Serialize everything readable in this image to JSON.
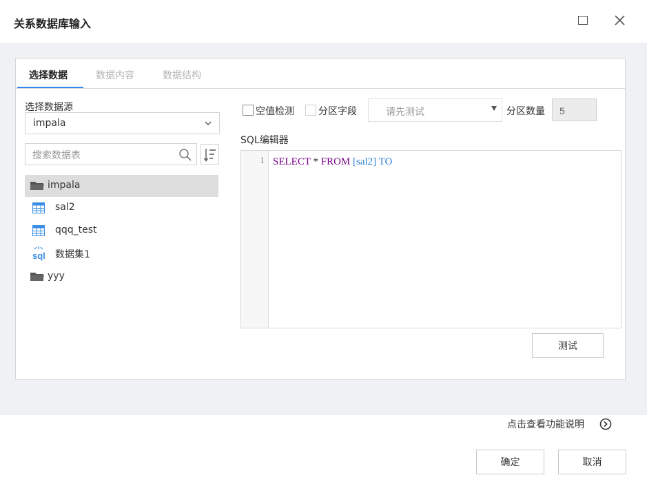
{
  "window": {
    "title": "关系数据库输入"
  },
  "tabs": [
    {
      "label": "选择数据",
      "active": true
    },
    {
      "label": "数据内容",
      "active": false
    },
    {
      "label": "数据结构",
      "active": false
    }
  ],
  "left": {
    "datasource_label": "选择数据源",
    "datasource_value": "impala",
    "search_placeholder": "搜索数据表",
    "tree": [
      {
        "label": "impala",
        "icon": "folder-open-icon",
        "selected": true
      },
      {
        "label": "sal2",
        "icon": "table-icon"
      },
      {
        "label": "qqq_test",
        "icon": "table-icon"
      },
      {
        "label": "数据集1",
        "icon": "sql-icon"
      },
      {
        "label": "yyy",
        "icon": "folder-icon"
      }
    ]
  },
  "right": {
    "null_check_label": "空值检测",
    "partition_field_label": "分区字段",
    "partition_select_value": "请先测试",
    "partition_count_label": "分区数量",
    "partition_count_value": "5",
    "sql_editor_label": "SQL编辑器",
    "line_number": "1",
    "code": {
      "kw1": "SELECT",
      "star": " * ",
      "kw2": "FROM",
      "ident": " [sal2] ",
      "kw3": "TO"
    },
    "test_button": "测试"
  },
  "footer": {
    "help_link": "点击查看功能说明",
    "ok_button": "确定",
    "cancel_button": "取消"
  },
  "colors": {
    "accent": "#3685f2",
    "keyword_purple": "#770088",
    "identifier_blue": "#2a7fd4",
    "table_icon_blue": "#3a8ee6",
    "folder_gray": "#555555"
  }
}
